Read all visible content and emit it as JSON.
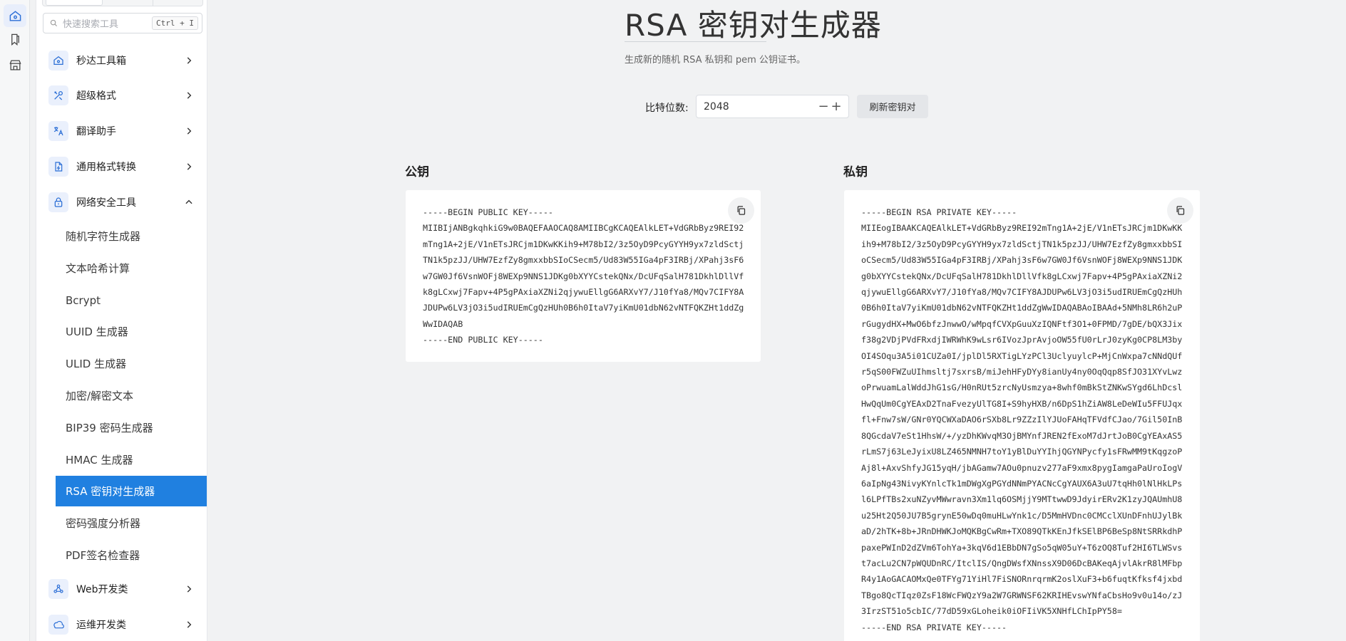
{
  "rail": [
    {
      "name": "home-icon"
    },
    {
      "name": "bookmark-icon"
    },
    {
      "name": "store-icon"
    }
  ],
  "search": {
    "placeholder": "快速搜索工具",
    "shortcut": "Ctrl + I"
  },
  "sidebar": {
    "categories": [
      {
        "label": "秒达工具箱",
        "icon": "home-icon",
        "expanded": false
      },
      {
        "label": "超级格式",
        "icon": "tools-icon",
        "expanded": false
      },
      {
        "label": "翻译助手",
        "icon": "translate-icon",
        "expanded": false
      },
      {
        "label": "通用格式转换",
        "icon": "file-convert-icon",
        "expanded": false
      },
      {
        "label": "网络安全工具",
        "icon": "lock-icon",
        "expanded": true
      },
      {
        "label": "Web开发类",
        "icon": "webhook-icon",
        "expanded": false
      },
      {
        "label": "运维开发类",
        "icon": "cloud-ops-icon",
        "expanded": false
      }
    ],
    "security_items": [
      "随机字符生成器",
      "文本哈希计算",
      "Bcrypt",
      "UUID 生成器",
      "ULID 生成器",
      "加密/解密文本",
      "BIP39 密码生成器",
      "HMAC 生成器",
      "RSA 密钥对生成器",
      "密码强度分析器",
      "PDF签名检查器"
    ],
    "active_item": "RSA 密钥对生成器"
  },
  "page": {
    "title": "RSA 密钥对生成器",
    "subtitle": "生成新的随机 RSA 私钥和 pem 公钥证书。",
    "bits_label": "比特位数:",
    "bits_value": "2048",
    "minus": "−",
    "plus": "+",
    "refresh_label": "刷新密钥对"
  },
  "public_key": {
    "title": "公钥",
    "text": "-----BEGIN PUBLIC KEY-----\nMIIBIjANBgkqhkiG9w0BAQEFAAOCAQ8AMIIBCgKCAQEAlkLET+VdGRbByz9REI92\nmTng1A+2jE/V1nETsJRCjm1DKwKKih9+M78bI2/3z5OyD9PcyGYYH9yx7zldSctj\nTN1k5pzJJ/UHW7EzfZy8gmxxbbSIoCSecm5/Ud83W55IGa4pF3IRBj/XPahj3sF6\nw7GW0Jf6VsnWOFj8WEXp9NNS1JDKg0bXYYCstekQNx/DcUFqSalH781DkhlDllVf\nk8gLCxwj7Fapv+4P5gPAxiaXZNi2qjywuEllgG6ARXvY7/J10fYa8/MQv7CIFY8A\nJDUPw6LV3jO3i5udIRUEmCgQzHUh0B6h0ItaV7yiKmU01dbN62vNTFQKZHt1ddZg\nWwIDAQAB\n-----END PUBLIC KEY-----"
  },
  "private_key": {
    "title": "私钥",
    "text": "-----BEGIN RSA PRIVATE KEY-----\nMIIEogIBAAKCAQEAlkLET+VdGRbByz9REI92mTng1A+2jE/V1nETsJRCjm1DKwKK\nih9+M78bI2/3z5OyD9PcyGYYH9yx7zldSctjTN1k5pzJJ/UHW7EzfZy8gmxxbbSI\noCSecm5/Ud83W55IGa4pF3IRBj/XPahj3sF6w7GW0Jf6VsnWOFj8WEXp9NNS1JDK\ng0bXYYCstekQNx/DcUFqSalH781DkhlDllVfk8gLCxwj7Fapv+4P5gPAxiaXZNi2\nqjywuEllgG6ARXvY7/J10fYa8/MQv7CIFY8AJDUPw6LV3jO3i5udIRUEmCgQzHUh\n0B6h0ItaV7yiKmU01dbN62vNTFQKZHt1ddZgWwIDAQABAoIBAAd+5NMh8LR6h2uP\nrGugydHX+MwO6bfzJnwwO/wMpqfCVXpGuuXzIQNFtf3O1+0FPMD/7gDE/bQX3Jix\nf38g2VDjPVdFRxdjIWRWhK9wLsr6IVozJprAvjoOW55fU0rLrJ0zyKg0CP8LM3by\nOI4SOqu3A5i01CUZa0I/jplDl5RXTigLYzPCl3UclyuylcP+MjCnWxpa7cNNdQUf\nr5qS00FWZuUIhmsltj7sxrsB/miJehHFyDYy8ianUy4ny0OqQqp8SfJO31XYvLwz\noPrwuamLalWddJhG1sG/H0nRUt5zrcNyUsmzya+8whf0mBkStZNKwSYgd6LhDcsl\nHwQqUm0CgYEAxD2TnaFvezyUlTG8I+S9hyHXB/n6DpS1hZiAW8LeDeWIu5FFUJqx\nfl+Fnw7sW/GNr0YQCWXaDAO6rSXb8Lr9ZZzIlYJUoFAHqTFVdfCJao/7Gil50InB\n8QGcdaV7eSt1HhsW/+/yzDhKWvqM3OjBMYnfJREN2fExoM7dJrtJoB0CgYEAxAS5\nrLmS7j63LeJyixU8LZ465NMNH7toY1yBlDuYYIhjQGYNPycfy1sFRwMM9tKqgzoP\nAj8l+AxvShfyJG15yqH/jbAGamw7AOu0pnuzv277aF9xmx8pygIamgaPaUroIogV\n6aIpNg43NivyKYnlcTk1mDWgXgPGYdNNmPYACNcCgYAUX6A3uU7tqHh0lNlHkLPs\nl6LPfTBs2xuNZyvMWwravn3Xm1lq6OSMjjY9MTtwwD9JdyirERv2K1zyJQAUmhU8\nu25Ht2Q50JU7B5grynE50wDq0muHLwYnk1c/D5MmHVDnc0CMCclXUnDFnhUJylBk\naD/2hTK+8b+JRnDHWKJoMQKBgCwRm+TXO89QTkKEnJfkSElBP6BeSp8NtSRRkdhP\npaxePWInD2dZVm6TohYa+3kqV6d1EBbDN7gSo5qW05uY+T6zOQ8Tuf2HI6TLWSvs\nt7acLu2CN7pWQUDnRC/ItclIS/QngDWsfXNnssX9D06DcBAKeqAjvlAkrR8lMFbp\nR4y1AoGACAOMxQe0TFYg71YiHl7FiSNORnrqrmK2oslXuF3+b6fuqtKfksf4jxbd\nTBgo8QcTIqz0ZsF18WcFWQzY9a2W7GRWNSF62KRIHEvswYNfaCbsHo9v0u14o/zJ\n3IrzST51o5cbIC/77dD59xGLoheik0iOFIiVK5XNHfLChIpPY58=\n-----END RSA PRIVATE KEY-----"
  },
  "colors": {
    "accent": "#2080e0",
    "icon": "#2c6fd6"
  }
}
